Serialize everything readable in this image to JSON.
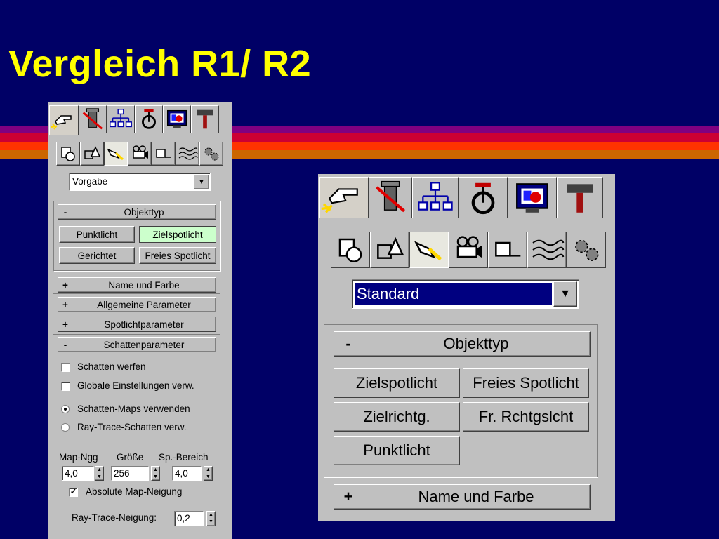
{
  "slide": {
    "title": "Vergleich R1/ R2",
    "colors": {
      "background": "#000066",
      "title": "#ffff00",
      "stripes": [
        "#800080",
        "#cc0033",
        "#ff3300",
        "#cc6600"
      ]
    }
  },
  "r1_panel": {
    "tabs": [
      "create-icon",
      "modify-icon",
      "hierarchy-icon",
      "motion-icon",
      "display-icon",
      "utilities-icon"
    ],
    "category_icons": [
      "geometry-icon",
      "shapes-icon",
      "lights-icon",
      "cameras-icon",
      "helpers-icon",
      "spacewarps-icon",
      "systems-icon"
    ],
    "dropdown_value": "Vorgabe",
    "objekttyp": {
      "sign": "-",
      "label": "Objekttyp",
      "buttons": [
        "Punktlicht",
        "Zielspotlicht",
        "Gerichtet",
        "Freies Spotlicht"
      ]
    },
    "rollouts": [
      {
        "sign": "+",
        "label": "Name und Farbe"
      },
      {
        "sign": "+",
        "label": "Allgemeine Parameter"
      },
      {
        "sign": "+",
        "label": "Spotlichtparameter"
      },
      {
        "sign": "-",
        "label": "Schattenparameter"
      }
    ],
    "shadow": {
      "cast_shadows": "Schatten werfen",
      "global_settings": "Globale Einstellungen verw.",
      "use_shadow_maps": "Schatten-Maps verwenden",
      "raytrace_shadows": "Ray-Trace-Schatten verw.",
      "map_bias_label": "Map-Ngg",
      "size_label": "Größe",
      "sample_range_label": "Sp.-Bereich",
      "map_bias_value": "4,0",
      "size_value": "256",
      "sample_range_value": "4,0",
      "absolute_bias": "Absolute Map-Neigung",
      "raytrace_bias_label": "Ray-Trace-Neigung:",
      "raytrace_bias_value": "0,2"
    }
  },
  "r2_panel": {
    "tabs": [
      "create-icon",
      "modify-icon",
      "hierarchy-icon",
      "motion-icon",
      "display-icon",
      "utilities-icon"
    ],
    "category_icons": [
      "geometry-icon",
      "shapes-icon",
      "lights-icon",
      "cameras-icon",
      "helpers-icon",
      "spacewarps-icon",
      "systems-icon"
    ],
    "dropdown_value": "Standard",
    "objekttyp": {
      "sign": "-",
      "label": "Objekttyp",
      "buttons": [
        "Zielspotlicht",
        "Freies Spotlicht",
        "Zielrichtg.",
        "Fr. Rchtgslcht",
        "Punktlicht"
      ]
    },
    "rollouts": [
      {
        "sign": "+",
        "label": "Name und Farbe"
      }
    ],
    "highlight_color": "#000080"
  }
}
